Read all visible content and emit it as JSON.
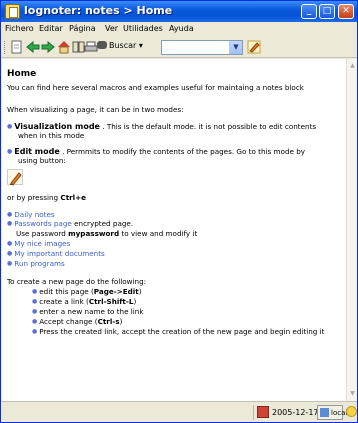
{
  "window": {
    "title": "lognoter: notes > Home"
  },
  "menu": [
    "Fichero",
    "Editar",
    "Página",
    "Ver",
    "Utilidades",
    "Ayuda"
  ],
  "toolbar": {
    "search_label": "Buscar",
    "search_value": ""
  },
  "content": {
    "heading": "Home",
    "intro": "You can find here several macros and examples useful for maintaing a notes block",
    "modes_intro": "When visualizing a page, it can be in two modes:",
    "viz_title": "Visualization mode",
    "viz_text": " . This is the default mode. it is not possible to edit contents",
    "viz_text2": "when in this mode",
    "edit_title": "Edit mode",
    "edit_text": " . Permmits to modify the contents of the pages. Go to this mode by",
    "edit_text2": "using button:",
    "press_prefix": "or by pressing ",
    "press_key": "Ctrl+e",
    "links": {
      "daily": "Daily notes",
      "passwords": "Passwords page",
      "passwords_suffix": " encrypted page.",
      "pw_prefix": "Use password ",
      "pw_value": "mypassword",
      "pw_suffix": " to view and modify it",
      "images": "My nice images",
      "docs": "My important documents",
      "run": "Run programs"
    },
    "create_intro": "To create a new page do the following:",
    "steps": {
      "s1_prefix": "edit this page (",
      "s1_bold": "Page->Edit",
      "s1_suffix": ")",
      "s2_prefix": "create a link (",
      "s2_bold": "Ctrl-Shift-L",
      "s2_suffix": ")",
      "s3": "enter a new name to the link",
      "s4_prefix": "Accept change (",
      "s4_bold": "Ctrl-s",
      "s4_suffix": ")",
      "s5": "Press the created link, accept the creation of the new page and begin editing it"
    }
  },
  "status": {
    "date": "2005-12-17",
    "location": "local"
  },
  "colors": {
    "titlebar": "#0553d6",
    "link": "#3a5fcd",
    "bullet": "#5a6fd6"
  }
}
